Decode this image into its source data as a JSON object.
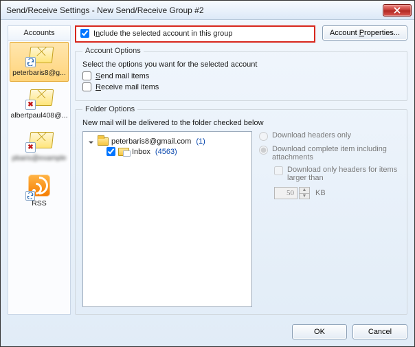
{
  "window": {
    "title": "Send/Receive Settings - New Send/Receive Group #2"
  },
  "accounts_header": "Accounts",
  "accounts": [
    {
      "label": "peterbaris8@g...",
      "status": "sync",
      "selected": true,
      "blurred": false
    },
    {
      "label": "albertpaul408@...",
      "status": "error",
      "selected": false,
      "blurred": false
    },
    {
      "label": "pbaris@example",
      "status": "error",
      "selected": false,
      "blurred": true
    },
    {
      "label": "RSS",
      "status": "rss",
      "selected": false,
      "blurred": false
    }
  ],
  "include": {
    "label_pre": "I",
    "label_mn": "n",
    "label_post": "clude the selected account in this group",
    "checked": true
  },
  "account_properties_btn": {
    "pre": "Account ",
    "mn": "P",
    "post": "roperties..."
  },
  "account_options": {
    "legend": "Account Options",
    "hint": "Select the options you want for the selected account",
    "send": {
      "pre": "",
      "mn": "S",
      "post": "end mail items",
      "checked": false
    },
    "receive": {
      "pre": "",
      "mn": "R",
      "post": "eceive mail items",
      "checked": false
    }
  },
  "folder_options": {
    "legend": "Folder Options",
    "hint": "New mail will be delivered to the folder checked below",
    "root": {
      "name": "peterbaris8@gmail.com",
      "count": "(1)"
    },
    "inbox": {
      "name": "Inbox",
      "count": "(4563)",
      "checked": true
    }
  },
  "download": {
    "headers_only": "Download headers only",
    "complete": "Download complete item including attachments",
    "only_headers_larger": "Download only headers for items larger than",
    "size_value": "50",
    "size_unit": "KB",
    "selected": "complete"
  },
  "footer": {
    "ok": "OK",
    "cancel": "Cancel"
  }
}
